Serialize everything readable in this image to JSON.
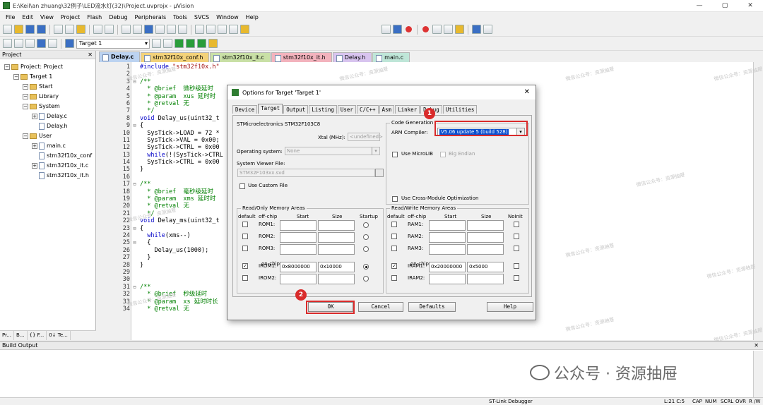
{
  "window": {
    "title": "E:\\Keil\\an zhuang\\32例子\\LED流水灯(32)\\Project.uvprojx - µVision",
    "min": "—",
    "max": "▢",
    "close": "✕"
  },
  "menu": [
    "File",
    "Edit",
    "View",
    "Project",
    "Flash",
    "Debug",
    "Peripherals",
    "Tools",
    "SVCS",
    "Window",
    "Help"
  ],
  "toolbar": {
    "target": "Target 1"
  },
  "project_pane": {
    "title": "Project",
    "pin": "ᵖ",
    "close": "✕",
    "tree": [
      {
        "label": "Project: Project",
        "level": 0,
        "kind": "root"
      },
      {
        "label": "Target 1",
        "level": 1,
        "kind": "target"
      },
      {
        "label": "Start",
        "level": 2,
        "kind": "folder"
      },
      {
        "label": "Library",
        "level": 2,
        "kind": "folder"
      },
      {
        "label": "System",
        "level": 2,
        "kind": "folder"
      },
      {
        "label": "Delay.c",
        "level": 3,
        "kind": "file"
      },
      {
        "label": "Delay.h",
        "level": 3,
        "kind": "file"
      },
      {
        "label": "User",
        "level": 2,
        "kind": "folder"
      },
      {
        "label": "main.c",
        "level": 3,
        "kind": "file"
      },
      {
        "label": "stm32f10x_conf",
        "level": 3,
        "kind": "file"
      },
      {
        "label": "stm32f10x_it.c",
        "level": 3,
        "kind": "file"
      },
      {
        "label": "stm32f10x_it.h",
        "level": 3,
        "kind": "file"
      }
    ],
    "tabs": [
      "Pr...",
      "B...",
      "{} F...",
      "0↓ Te..."
    ]
  },
  "file_tabs": [
    {
      "label": "Delay.c",
      "color": "#bcd3f1",
      "active": true
    },
    {
      "label": "stm32f10x_conf.h",
      "color": "#f3d27a"
    },
    {
      "label": "stm32f10x_it.c",
      "color": "#c9e0a6"
    },
    {
      "label": "stm32f10x_it.h",
      "color": "#f3b3bd"
    },
    {
      "label": "Delay.h",
      "color": "#d8c4ef"
    },
    {
      "label": "main.c",
      "color": "#bfe6d8"
    }
  ],
  "code": [
    {
      "n": "1",
      "f": "",
      "html": "<span class='pp'>#include</span> <span class='str'>\"stm32f10x.h\"</span>"
    },
    {
      "n": "2",
      "f": "",
      "html": ""
    },
    {
      "n": "3",
      "f": "⊟",
      "html": "<span class='cm'>/**</span>"
    },
    {
      "n": "4",
      "f": "",
      "html": "<span class='cm'>  * @brief  微秒级延时</span>"
    },
    {
      "n": "5",
      "f": "",
      "html": "<span class='cm'>  * @param  xus 延时时</span>"
    },
    {
      "n": "6",
      "f": "",
      "html": "<span class='cm'>  * @retval 无</span>"
    },
    {
      "n": "7",
      "f": "",
      "html": "<span class='cm'>  */</span>"
    },
    {
      "n": "8",
      "f": "",
      "html": "<span class='kw'>void</span> Delay_us(uint32_t"
    },
    {
      "n": "9",
      "f": "⊟",
      "html": "{"
    },
    {
      "n": "10",
      "f": "",
      "html": "  SysTick->LOAD = 72 *"
    },
    {
      "n": "11",
      "f": "",
      "html": "  SysTick->VAL = 0x00;"
    },
    {
      "n": "12",
      "f": "",
      "html": "  SysTick->CTRL = 0x00"
    },
    {
      "n": "13",
      "f": "",
      "html": "  <span class='kw'>while</span>(!(SysTick->CTRL"
    },
    {
      "n": "14",
      "f": "",
      "html": "  SysTick->CTRL = 0x00"
    },
    {
      "n": "15",
      "f": "",
      "html": "}"
    },
    {
      "n": "16",
      "f": "",
      "html": ""
    },
    {
      "n": "17",
      "f": "⊟",
      "html": "<span class='cm'>/**</span>"
    },
    {
      "n": "18",
      "f": "",
      "html": "<span class='cm'>  * @brief  毫秒级延时</span>"
    },
    {
      "n": "19",
      "f": "",
      "html": "<span class='cm'>  * @param  xms 延时时</span>"
    },
    {
      "n": "20",
      "f": "",
      "html": "<span class='cm'>  * @retval 无</span>"
    },
    {
      "n": "21",
      "f": "",
      "html": "<span class='cm'>  */</span>"
    },
    {
      "n": "22",
      "f": "",
      "html": "<span class='kw'>void</span> Delay_ms(uint32_t"
    },
    {
      "n": "23",
      "f": "⊟",
      "html": "{"
    },
    {
      "n": "24",
      "f": "",
      "html": "  <span class='kw'>while</span>(xms--)"
    },
    {
      "n": "25",
      "f": "⊟",
      "html": "  {"
    },
    {
      "n": "26",
      "f": "",
      "html": "    Delay_us(1000);"
    },
    {
      "n": "27",
      "f": "",
      "html": "  }"
    },
    {
      "n": "28",
      "f": "",
      "html": "}"
    },
    {
      "n": "29",
      "f": "",
      "html": ""
    },
    {
      "n": "30",
      "f": "",
      "html": ""
    },
    {
      "n": "31",
      "f": "⊟",
      "html": "<span class='cm'>/**</span>"
    },
    {
      "n": "32",
      "f": "",
      "html": "<span class='cm'>  * @brief  秒级延时</span>"
    },
    {
      "n": "33",
      "f": "",
      "html": "<span class='cm'>  * @param  xs 延时时长</span>"
    },
    {
      "n": "34",
      "f": "",
      "html": "<span class='cm'>  * @retval 无</span>"
    }
  ],
  "watermark": "微信公众号：资源抽屉",
  "dialog": {
    "title": "Options for Target 'Target 1'",
    "close": "✕",
    "tabs": [
      "Device",
      "Target",
      "Output",
      "Listing",
      "User",
      "C/C++",
      "Asm",
      "Linker",
      "Debug",
      "Utilities"
    ],
    "active_tab": "Target",
    "device": "STMicroelectronics STM32F103C8",
    "xtal_label": "Xtal (MHz):",
    "xtal_value": "<undefined>",
    "os_label": "Operating system:",
    "os_value": "None",
    "svf_label": "System Viewer File:",
    "svf_value": "STM32F103xx.svd",
    "use_custom_file": "Use Custom File",
    "codegen_group": "Code Generation",
    "arm_compiler_label": "ARM Compiler:",
    "arm_compiler_value": "V5.06 update 5 (build 528)",
    "use_microlib": "Use MicroLIB",
    "big_endian": "Big Endian",
    "use_cross_module": "Use Cross-Module Optimization",
    "ro_group": "Read/Only Memory Areas",
    "rw_group": "Read/Write Memory Areas",
    "col_default": "default",
    "col_offchip": "off-chip",
    "col_start": "Start",
    "col_size": "Size",
    "col_startup": "Startup",
    "col_noinit": "NoInit",
    "on_chip": "on-chip",
    "rom_rows": [
      {
        "label": "ROM1:",
        "start": "",
        "size": "",
        "default": false,
        "startup": false
      },
      {
        "label": "ROM2:",
        "start": "",
        "size": "",
        "default": false,
        "startup": false
      },
      {
        "label": "ROM3:",
        "start": "",
        "size": "",
        "default": false,
        "startup": false
      },
      {
        "label": "IROM1:",
        "start": "0x8000000",
        "size": "0x10000",
        "default": true,
        "startup": true
      },
      {
        "label": "IROM2:",
        "start": "",
        "size": "",
        "default": false,
        "startup": false
      }
    ],
    "ram_rows": [
      {
        "label": "RAM1:",
        "start": "",
        "size": "",
        "default": false
      },
      {
        "label": "RAM2:",
        "start": "",
        "size": "",
        "default": false
      },
      {
        "label": "RAM3:",
        "start": "",
        "size": "",
        "default": false
      },
      {
        "label": "IRAM1:",
        "start": "0x20000000",
        "size": "0x5000",
        "default": true
      },
      {
        "label": "IRAM2:",
        "start": "",
        "size": "",
        "default": false
      }
    ],
    "buttons": {
      "ok": "OK",
      "cancel": "Cancel",
      "defaults": "Defaults",
      "help": "Help"
    },
    "badges": [
      "1",
      "2"
    ]
  },
  "build_output": {
    "title": "Build Output",
    "pin": "ᵖ",
    "close": "✕"
  },
  "wechat_brand": "公众号 · 资源抽屉",
  "status": {
    "debugger": "ST-Link Debugger",
    "position": "L:21 C:5",
    "cap": "CAP",
    "num": "NUM",
    "scrl": "SCRL",
    "ovr": "OVR",
    "rw": "R /W"
  }
}
